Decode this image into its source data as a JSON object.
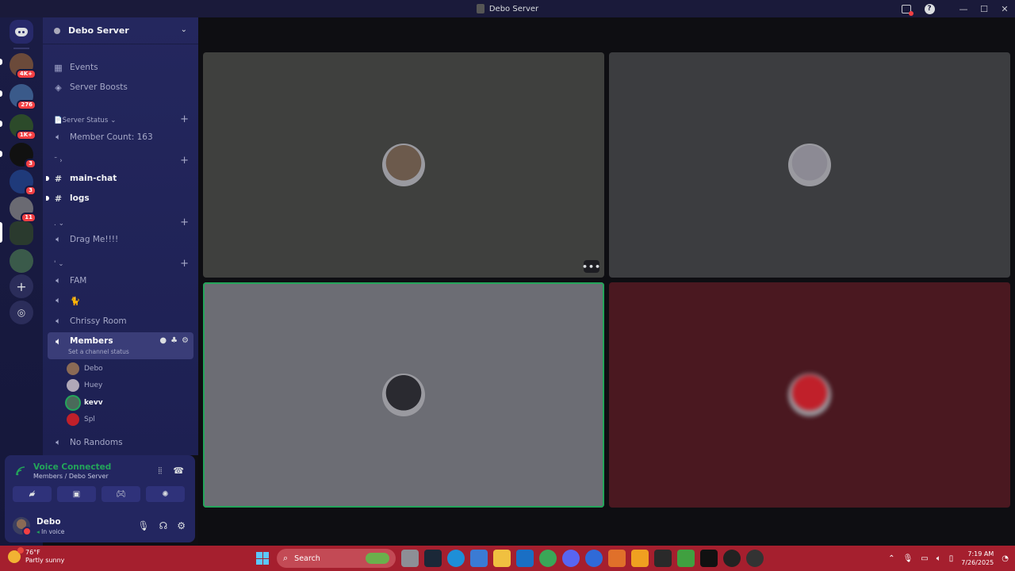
{
  "window": {
    "title": "Debo Server",
    "controls": {
      "minimize": "—",
      "maximize": "☐",
      "close": "✕"
    }
  },
  "rail": {
    "badges": [
      "4K+",
      "276",
      "1K+",
      "3",
      "3",
      "11"
    ]
  },
  "sidebar": {
    "server_name": "Debo Server",
    "top_items": [
      {
        "label": "Events",
        "icon": "calendar-icon"
      },
      {
        "label": "Server Boosts",
        "icon": "boost-icon"
      }
    ],
    "categories": {
      "server_status": "📄Server Status",
      "cat2": "˜",
      "cat3": ".",
      "cat4": "'"
    },
    "channels": {
      "member_count": "Member Count: 163",
      "main_chat": "main-chat",
      "logs": "logs",
      "drag_me": "Drag Me!!!!",
      "fam": "FAM",
      "emoji_channel": "🐈",
      "chrissy_room": "Chrissy Room",
      "members": "Members",
      "members_status": "Set a channel status",
      "no_randoms": "No Randoms"
    },
    "voice_members": [
      {
        "name": "Debo",
        "color": "#8a6a55"
      },
      {
        "name": "Huey",
        "color": "#b0a8b8"
      },
      {
        "name": "kevv",
        "color": "#4a6a5a"
      },
      {
        "name": "Spl",
        "color": "#c0202a"
      }
    ]
  },
  "voice_panel": {
    "title": "Voice Connected",
    "subtitle": "Members / Debo Server",
    "status_color": "#23a55a"
  },
  "user": {
    "name": "Debo",
    "status": "In voice"
  },
  "stage": {
    "tiles": [
      {
        "bg": "#3f403e",
        "avatar_bg": "#6c5a4c",
        "speaking": false
      },
      {
        "bg": "#3c3d40",
        "avatar_bg": "#8c8a94",
        "speaking": false
      },
      {
        "bg": "#6c6d74",
        "avatar_bg": "#2a2a30",
        "speaking": true
      },
      {
        "bg": "#4a1820",
        "avatar_bg": "#c0202a",
        "speaking": false
      }
    ],
    "more_label": "•••"
  },
  "taskbar": {
    "weather_temp": "76°F",
    "weather_desc": "Partly sunny",
    "search_label": "Search",
    "time": "7:19 AM",
    "date": "7/26/2025"
  },
  "colors": {
    "accent_green": "#23a55a",
    "badge_red": "#f23f43",
    "taskbar": "#a51f2e"
  }
}
